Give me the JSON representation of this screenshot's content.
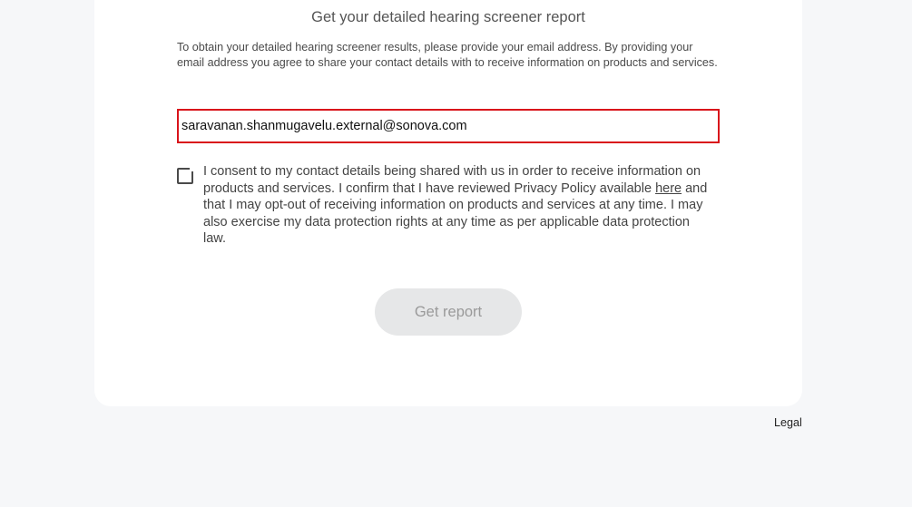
{
  "report": {
    "title": "Get your detailed hearing screener report",
    "intro": "To obtain your detailed hearing screener results, please provide your email address. By providing your email address you agree to share your contact details with to receive information on products and services.",
    "email_value": "saravanan.shanmugavelu.external@sonova.com",
    "consent_checked": false,
    "consent_text_before": "I consent to my contact details being shared with us in order to receive information on products and services. I confirm that I have reviewed Privacy Policy available ",
    "consent_link_label": "here",
    "consent_text_after": " and that I may opt-out of receiving information on products and services at any time. I may also exercise my data protection rights at any time as per applicable data protection law.",
    "button_label": "Get report"
  },
  "footer": {
    "legal_label": "Legal"
  },
  "colors": {
    "page_background": "#f6f7f9",
    "card_background": "#ffffff",
    "input_error_border": "#d9141b",
    "button_disabled_background": "#e6e7e8",
    "button_disabled_text": "#9a9a9a"
  }
}
